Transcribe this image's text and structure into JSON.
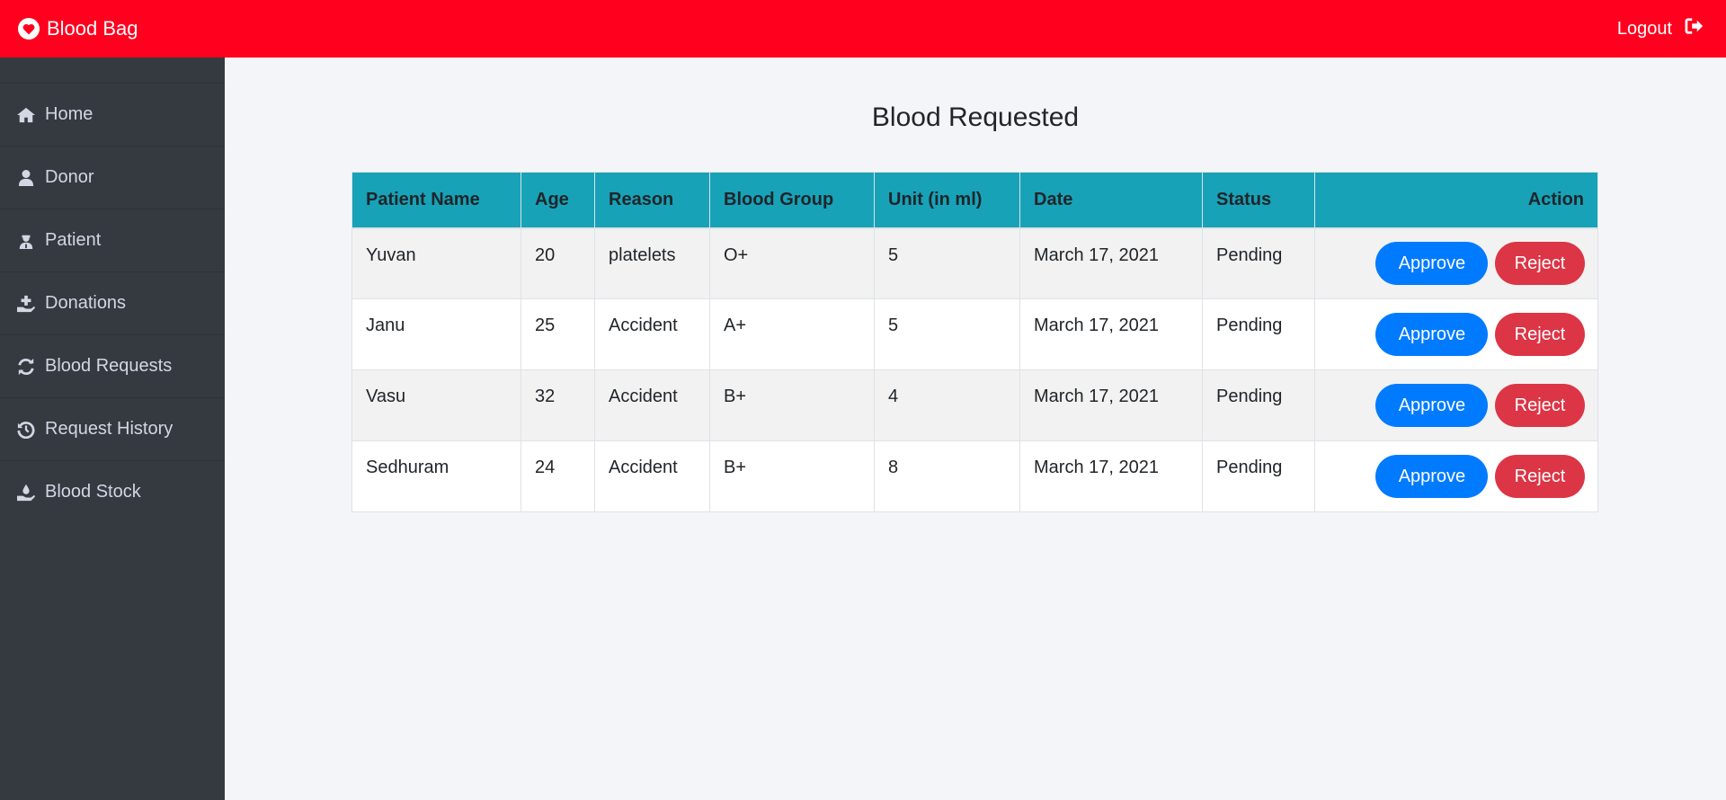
{
  "app": {
    "title": "Blood Bag"
  },
  "header": {
    "logout_label": "Logout"
  },
  "sidebar": {
    "items": [
      {
        "label": "Home",
        "icon": "home-icon"
      },
      {
        "label": "Donor",
        "icon": "user-icon"
      },
      {
        "label": "Patient",
        "icon": "patient-icon"
      },
      {
        "label": "Donations",
        "icon": "donation-icon"
      },
      {
        "label": "Blood Requests",
        "icon": "refresh-icon"
      },
      {
        "label": "Request History",
        "icon": "history-icon"
      },
      {
        "label": "Blood Stock",
        "icon": "hand-holding-drop-icon"
      }
    ]
  },
  "main": {
    "title": "Blood Requested",
    "table": {
      "headers": [
        "Patient Name",
        "Age",
        "Reason",
        "Blood Group",
        "Unit (in ml)",
        "Date",
        "Status",
        "Action"
      ],
      "rows": [
        {
          "name": "Yuvan",
          "age": "20",
          "reason": "platelets",
          "group": "O+",
          "unit": "5",
          "date": "March 17, 2021",
          "status": "Pending"
        },
        {
          "name": "Janu",
          "age": "25",
          "reason": "Accident",
          "group": "A+",
          "unit": "5",
          "date": "March 17, 2021",
          "status": "Pending"
        },
        {
          "name": "Vasu",
          "age": "32",
          "reason": "Accident",
          "group": "B+",
          "unit": "4",
          "date": "March 17, 2021",
          "status": "Pending"
        },
        {
          "name": "Sedhuram",
          "age": "24",
          "reason": "Accident",
          "group": "B+",
          "unit": "8",
          "date": "March 17, 2021",
          "status": "Pending"
        }
      ],
      "approve_label": "Approve",
      "reject_label": "Reject"
    }
  },
  "colors": {
    "topbar": "#ff001e",
    "sidebar": "#343a40",
    "table_header": "#17a2b8",
    "approve": "#007bff",
    "reject": "#dc3545"
  }
}
